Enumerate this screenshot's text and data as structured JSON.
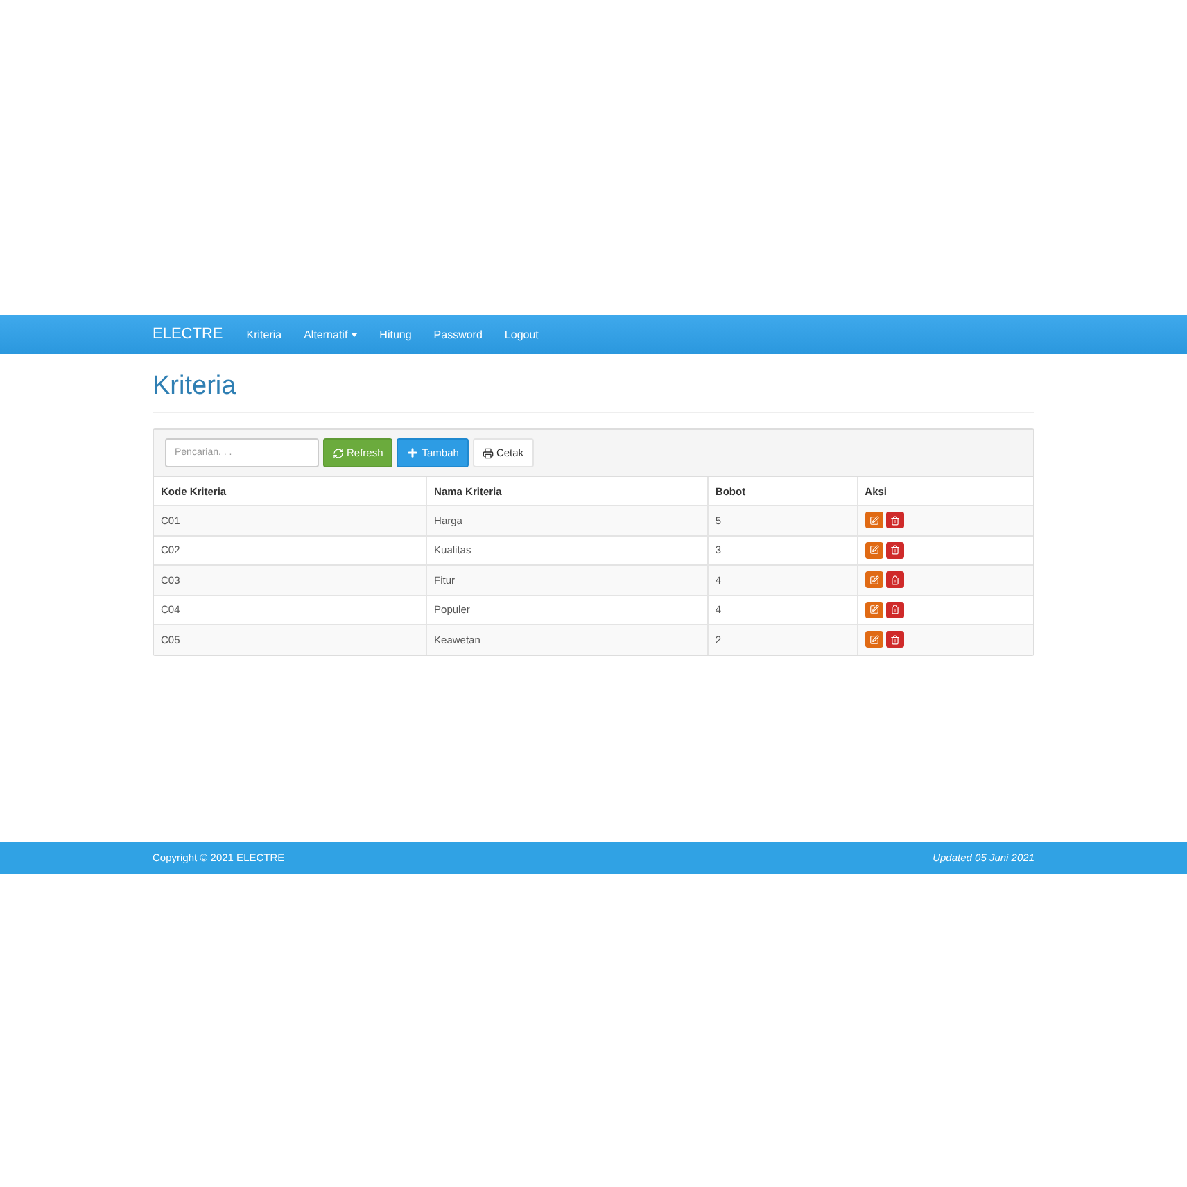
{
  "navbar": {
    "brand": "ELECTRE",
    "items": [
      {
        "label": "Kriteria",
        "dropdown": false
      },
      {
        "label": "Alternatif",
        "dropdown": true
      },
      {
        "label": "Hitung",
        "dropdown": false
      },
      {
        "label": "Password",
        "dropdown": false
      },
      {
        "label": "Logout",
        "dropdown": false
      }
    ]
  },
  "page_title": "Kriteria",
  "toolbar": {
    "search": {
      "placeholder": "Pencarian. . ."
    },
    "buttons": [
      {
        "label": "Refresh",
        "kind": "refresh"
      },
      {
        "label": "Tambah",
        "kind": "add"
      },
      {
        "label": "Cetak",
        "kind": "print"
      }
    ]
  },
  "table": {
    "columns": [
      "Kode Kriteria",
      "Nama Kriteria",
      "Bobot",
      "Aksi"
    ],
    "rows": [
      {
        "code": "C01",
        "name": "Harga",
        "weight": "5"
      },
      {
        "code": "C02",
        "name": "Kualitas",
        "weight": "3"
      },
      {
        "code": "C03",
        "name": "Fitur",
        "weight": "4"
      },
      {
        "code": "C04",
        "name": "Populer",
        "weight": "4"
      },
      {
        "code": "C05",
        "name": "Keawetan",
        "weight": "2"
      }
    ]
  },
  "footer": {
    "copyright": "Copyright © 2021 ELECTRE",
    "updated": "Updated 05 Juni 2021"
  }
}
